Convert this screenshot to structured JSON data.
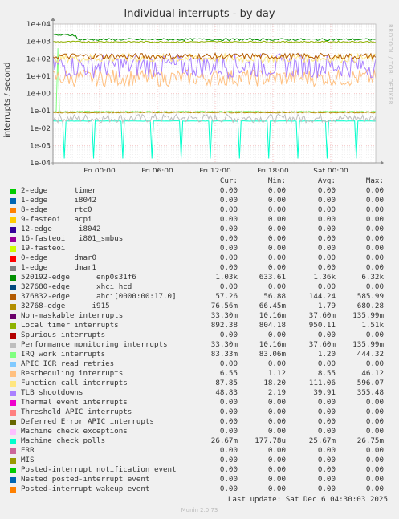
{
  "title": "Individual interrupts - by day",
  "watermark": "RRDTOOL / TOBI OETIKER",
  "footer": {
    "last_update": "Last update: Sat Dec  6 04:30:03 2025",
    "munin": "Munin 2.0.73"
  },
  "legend_headers": {
    "cur": "Cur:",
    "min": "Min:",
    "avg": "Avg:",
    "max": "Max:"
  },
  "chart_data": {
    "type": "line",
    "ylabel": "interrupts / second",
    "yscale": "log",
    "ylim": [
      0.0001,
      10000
    ],
    "yticks": [
      "1e-04",
      "1e-03",
      "1e-02",
      "1e-01",
      "1e+00",
      "1e+01",
      "1e+02",
      "1e+03",
      "1e+04"
    ],
    "xticks": [
      "Fri 00:00",
      "Fri 06:00",
      "Fri 12:00",
      "Fri 18:00",
      "Sat 00:00"
    ],
    "grid": true,
    "series": [
      {
        "name": "2-edge      timer",
        "color": "#00cc00",
        "cur": "0.00",
        "min": "0.00",
        "avg": "0.00",
        "max": "0.00"
      },
      {
        "name": "1-edge      i8042",
        "color": "#0066b3",
        "cur": "0.00",
        "min": "0.00",
        "avg": "0.00",
        "max": "0.00"
      },
      {
        "name": "8-edge      rtc0",
        "color": "#ff8000",
        "cur": "0.00",
        "min": "0.00",
        "avg": "0.00",
        "max": "0.00"
      },
      {
        "name": "9-fasteoi   acpi",
        "color": "#ffcc00",
        "cur": "0.00",
        "min": "0.00",
        "avg": "0.00",
        "max": "0.00"
      },
      {
        "name": "12-edge      i8042",
        "color": "#330099",
        "cur": "0.00",
        "min": "0.00",
        "avg": "0.00",
        "max": "0.00"
      },
      {
        "name": "16-fasteoi   i801_smbus",
        "color": "#990099",
        "cur": "0.00",
        "min": "0.00",
        "avg": "0.00",
        "max": "0.00"
      },
      {
        "name": "19-fasteoi",
        "color": "#ccff00",
        "cur": "0.00",
        "min": "0.00",
        "avg": "0.00",
        "max": "0.00"
      },
      {
        "name": "0-edge      dmar0",
        "color": "#ff0000",
        "cur": "0.00",
        "min": "0.00",
        "avg": "0.00",
        "max": "0.00"
      },
      {
        "name": "1-edge      dmar1",
        "color": "#808080",
        "cur": "0.00",
        "min": "0.00",
        "avg": "0.00",
        "max": "0.00"
      },
      {
        "name": "520192-edge      enp0s31f6",
        "color": "#008f00",
        "cur": "1.03k",
        "min": "633.61",
        "avg": "1.36k",
        "max": "6.32k"
      },
      {
        "name": "327680-edge      xhci_hcd",
        "color": "#00487d",
        "cur": "0.00",
        "min": "0.00",
        "avg": "0.00",
        "max": "0.00"
      },
      {
        "name": "376832-edge      ahci[0000:00:17.0]",
        "color": "#b35a00",
        "cur": "57.26",
        "min": "56.88",
        "avg": "144.24",
        "max": "585.99"
      },
      {
        "name": "32768-edge      i915",
        "color": "#b38f00",
        "cur": "76.56m",
        "min": "66.45m",
        "avg": "1.79",
        "max": "680.28"
      },
      {
        "name": "Non-maskable interrupts",
        "color": "#6b006b",
        "cur": "33.30m",
        "min": "10.16m",
        "avg": "37.60m",
        "max": "135.99m"
      },
      {
        "name": "Local timer interrupts",
        "color": "#8fb300",
        "cur": "892.38",
        "min": "804.18",
        "avg": "950.11",
        "max": "1.51k"
      },
      {
        "name": "Spurious interrupts",
        "color": "#b30000",
        "cur": "0.00",
        "min": "0.00",
        "avg": "0.00",
        "max": "0.00"
      },
      {
        "name": "Performance monitoring interrupts",
        "color": "#bebebe",
        "cur": "33.30m",
        "min": "10.16m",
        "avg": "37.60m",
        "max": "135.99m"
      },
      {
        "name": "IRQ work interrupts",
        "color": "#80ff80",
        "cur": "83.33m",
        "min": "83.06m",
        "avg": "1.20",
        "max": "444.32"
      },
      {
        "name": "APIC ICR read retries",
        "color": "#80c9ff",
        "cur": "0.00",
        "min": "0.00",
        "avg": "0.00",
        "max": "0.00"
      },
      {
        "name": "Rescheduling interrupts",
        "color": "#ffc080",
        "cur": "6.55",
        "min": "1.12",
        "avg": "8.55",
        "max": "46.12"
      },
      {
        "name": "Function call interrupts",
        "color": "#ffe680",
        "cur": "87.85",
        "min": "18.20",
        "avg": "111.06",
        "max": "596.07"
      },
      {
        "name": "TLB shootdowns",
        "color": "#aa80ff",
        "cur": "48.83",
        "min": "2.19",
        "avg": "39.91",
        "max": "355.48"
      },
      {
        "name": "Thermal event interrupts",
        "color": "#ee00cc",
        "cur": "0.00",
        "min": "0.00",
        "avg": "0.00",
        "max": "0.00"
      },
      {
        "name": "Threshold APIC interrupts",
        "color": "#ff8080",
        "cur": "0.00",
        "min": "0.00",
        "avg": "0.00",
        "max": "0.00"
      },
      {
        "name": "Deferred Error APIC interrupts",
        "color": "#666600",
        "cur": "0.00",
        "min": "0.00",
        "avg": "0.00",
        "max": "0.00"
      },
      {
        "name": "Machine check exceptions",
        "color": "#ffbfff",
        "cur": "0.00",
        "min": "0.00",
        "avg": "0.00",
        "max": "0.00"
      },
      {
        "name": "Machine check polls",
        "color": "#00ffcc",
        "cur": "26.67m",
        "min": "177.78u",
        "avg": "25.67m",
        "max": "26.75m"
      },
      {
        "name": "ERR",
        "color": "#cc6699",
        "cur": "0.00",
        "min": "0.00",
        "avg": "0.00",
        "max": "0.00"
      },
      {
        "name": "MIS",
        "color": "#999900",
        "cur": "0.00",
        "min": "0.00",
        "avg": "0.00",
        "max": "0.00"
      },
      {
        "name": "Posted-interrupt notification event",
        "color": "#00cc00",
        "cur": "0.00",
        "min": "0.00",
        "avg": "0.00",
        "max": "0.00"
      },
      {
        "name": "Nested posted-interrupt event",
        "color": "#0066b3",
        "cur": "0.00",
        "min": "0.00",
        "avg": "0.00",
        "max": "0.00"
      },
      {
        "name": "Posted-interrupt wakeup event",
        "color": "#ff8000",
        "cur": "0.00",
        "min": "0.00",
        "avg": "0.00",
        "max": "0.00"
      }
    ]
  }
}
